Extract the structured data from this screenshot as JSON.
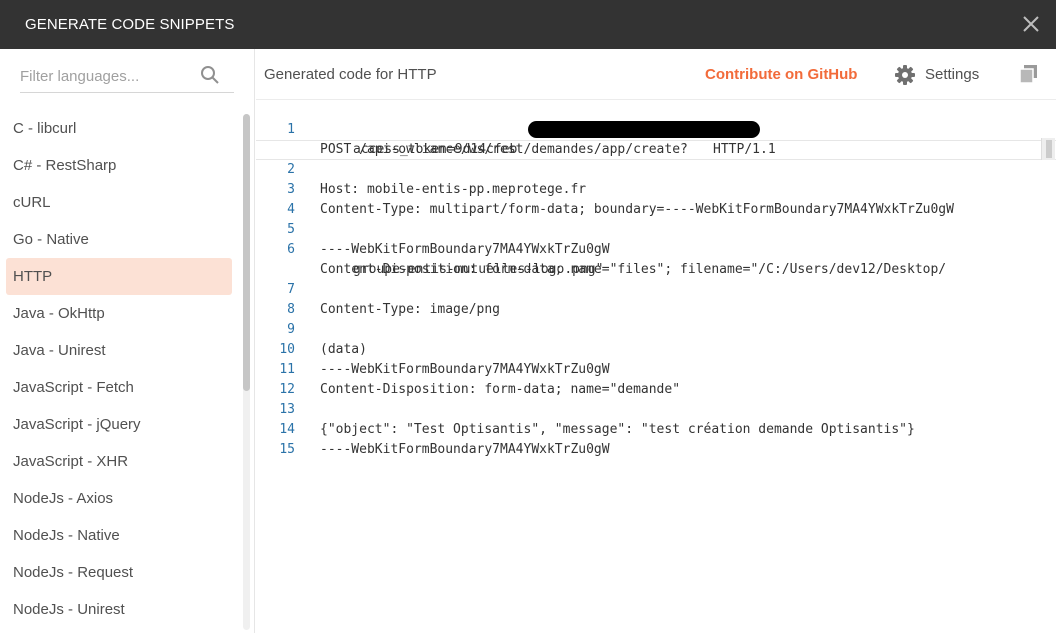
{
  "dialog": {
    "title": "GENERATE CODE SNIPPETS"
  },
  "sidebar": {
    "filter_placeholder": "Filter languages...",
    "items": [
      "C - libcurl",
      "C# - RestSharp",
      "cURL",
      "Go - Native",
      "HTTP",
      "Java - OkHttp",
      "Java - Unirest",
      "JavaScript - Fetch",
      "JavaScript - jQuery",
      "JavaScript - XHR",
      "NodeJs - Axios",
      "NodeJs - Native",
      "NodeJs - Request",
      "NodeJs - Unirest"
    ],
    "selected": "HTTP"
  },
  "header": {
    "generated_label": "Generated code for HTTP",
    "github_link": "Contribute on GitHub",
    "settings_label": "Settings"
  },
  "code": {
    "lines": [
      {
        "n": "1",
        "parts": [
          "POST /api-owliance/ws/rest/demandes/app/create?"
        ],
        "cont": "access_token=9d14cfeb                         HTTP/1.1"
      },
      {
        "n": "2",
        "parts": [
          "Host: mobile-entis-pp.meprotege.fr"
        ]
      },
      {
        "n": "3",
        "parts": [
          "Content-Type: multipart/form-data; boundary=----WebKitFormBoundary7MA4YWxkTrZu0gW"
        ]
      },
      {
        "n": "4",
        "parts": [
          ""
        ]
      },
      {
        "n": "5",
        "parts": [
          "----WebKitFormBoundary7MA4YWxkTrZu0gW"
        ]
      },
      {
        "n": "6",
        "parts": [
          "Content-Disposition: form-data; name=\"files\"; filename=\"/C:/Users/dev12/Desktop/"
        ],
        "cont": "groupe-entis-mutuelles-logo.png\""
      },
      {
        "n": "7",
        "parts": [
          "Content-Type: image/png"
        ]
      },
      {
        "n": "8",
        "parts": [
          ""
        ]
      },
      {
        "n": "9",
        "parts": [
          "(data)"
        ]
      },
      {
        "n": "10",
        "parts": [
          "----WebKitFormBoundary7MA4YWxkTrZu0gW"
        ]
      },
      {
        "n": "11",
        "parts": [
          "Content-Disposition: form-data; name=\"demande\""
        ]
      },
      {
        "n": "12",
        "parts": [
          ""
        ]
      },
      {
        "n": "13",
        "parts": [
          "{\"object\": \"Test Optisantis\", \"message\": \"test création demande Optisantis\"}"
        ]
      },
      {
        "n": "14",
        "parts": [
          "----WebKitFormBoundary7MA4YWxkTrZu0gW"
        ]
      },
      {
        "n": "15",
        "parts": [
          ""
        ]
      }
    ]
  },
  "colors": {
    "titlebar": "#333333",
    "accent": "#f26b3a",
    "selected_bg": "#fce1d5",
    "line_number": "#2a72a8"
  },
  "icons": {
    "close": "close-icon",
    "search": "search-icon",
    "settings": "gear-icon",
    "copy": "copy-icon"
  }
}
